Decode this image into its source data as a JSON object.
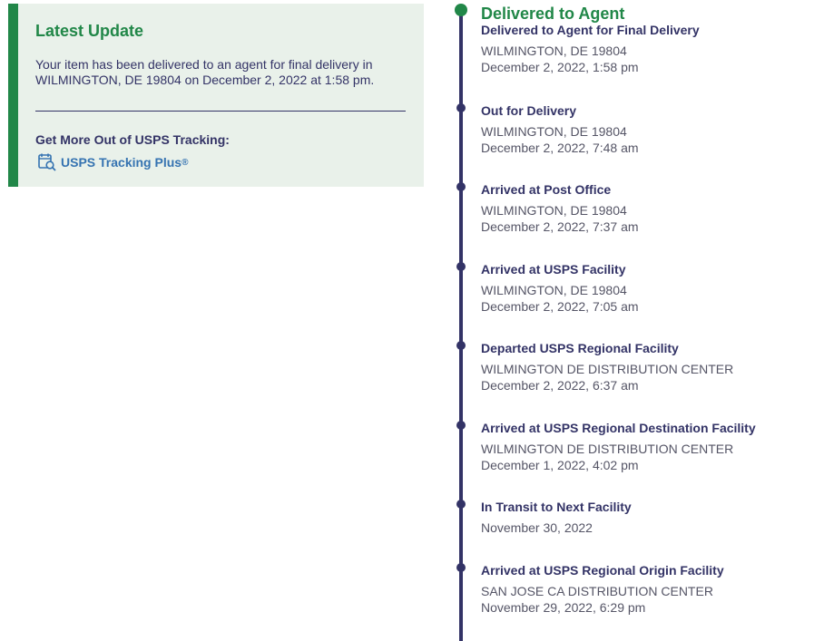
{
  "latest_update": {
    "title": "Latest Update",
    "message": "Your item has been delivered to an agent for final delivery in WILMINGTON, DE 19804 on December 2, 2022 at 1:58 pm.",
    "more_label": "Get More Out of USPS Tracking:",
    "tracking_plus_label": "USPS Tracking Plus",
    "tracking_plus_sup": "®",
    "icon": "tracking-plus-icon"
  },
  "timeline": {
    "headline": "Delivered to Agent",
    "events": [
      {
        "status": "Delivered to Agent for Final Delivery",
        "location": "WILMINGTON, DE 19804",
        "datetime": "December 2, 2022, 1:58 pm"
      },
      {
        "status": "Out for Delivery",
        "location": "WILMINGTON, DE 19804",
        "datetime": "December 2, 2022, 7:48 am"
      },
      {
        "status": "Arrived at Post Office",
        "location": "WILMINGTON, DE 19804",
        "datetime": "December 2, 2022, 7:37 am"
      },
      {
        "status": "Arrived at USPS Facility",
        "location": "WILMINGTON, DE 19804",
        "datetime": "December 2, 2022, 7:05 am"
      },
      {
        "status": "Departed USPS Regional Facility",
        "location": "WILMINGTON DE DISTRIBUTION CENTER",
        "datetime": "December 2, 2022, 6:37 am"
      },
      {
        "status": "Arrived at USPS Regional Destination Facility",
        "location": "WILMINGTON DE DISTRIBUTION CENTER",
        "datetime": "December 1, 2022, 4:02 pm"
      },
      {
        "status": "In Transit to Next Facility",
        "location": "",
        "datetime": "November 30, 2022"
      },
      {
        "status": "Arrived at USPS Regional Origin Facility",
        "location": "SAN JOSE CA DISTRIBUTION CENTER",
        "datetime": "November 29, 2022, 6:29 pm"
      }
    ]
  },
  "colors": {
    "brand_green": "#218748",
    "brand_navy": "#333366",
    "link_blue": "#3573b1",
    "panel_bg": "#e9f1ea"
  }
}
